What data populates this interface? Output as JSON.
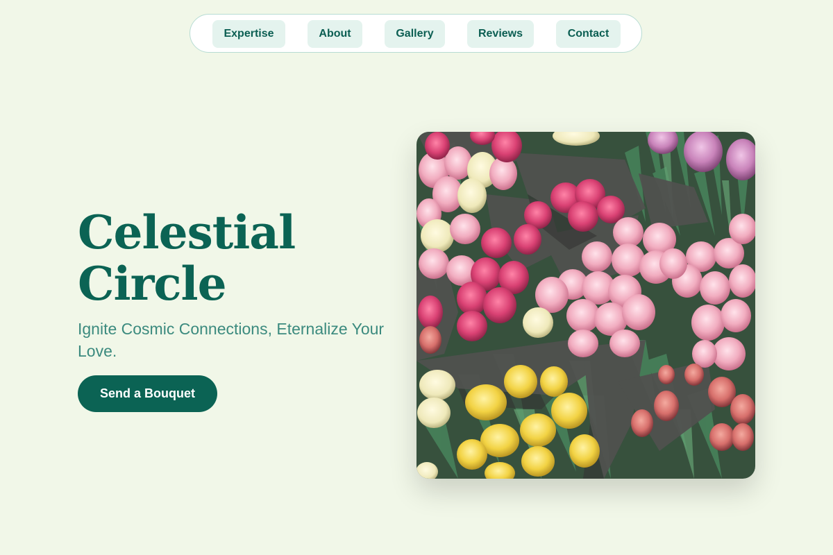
{
  "nav": {
    "items": [
      {
        "label": "Expertise"
      },
      {
        "label": "About"
      },
      {
        "label": "Gallery"
      },
      {
        "label": "Reviews"
      },
      {
        "label": "Contact"
      }
    ]
  },
  "hero": {
    "title_line1": "Celestial",
    "title_line2": "Circle",
    "subtitle": "Ignite Cosmic Connections, Eternalize Your Love.",
    "cta_label": "Send a Bouquet",
    "image_alt": "tulip-bouquets-photo"
  },
  "colors": {
    "background": "#f1f7e8",
    "accent": "#0b6354",
    "nav_pill": "#e4f3ee",
    "subtitle": "#3b8a7e"
  }
}
